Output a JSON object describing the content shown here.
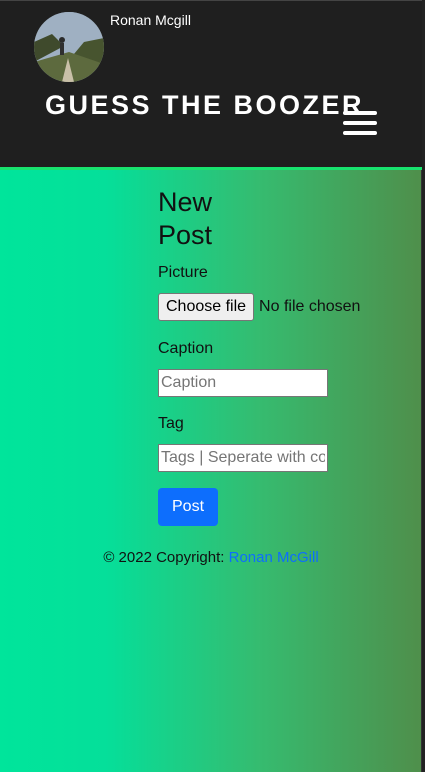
{
  "header": {
    "username": "Ronan Mcgill",
    "brand": "GUESS THE BOOZER",
    "menu_icon": "hamburger-menu-icon"
  },
  "form": {
    "title": "New Post",
    "picture_label": "Picture",
    "file_button": "Choose file",
    "file_status": "No file chosen",
    "caption_label": "Caption",
    "caption_placeholder": "Caption",
    "tag_label": "Tag",
    "tag_placeholder": "Tags | Seperate with commas",
    "submit_label": "Post"
  },
  "footer": {
    "copyright": "© 2022 Copyright: ",
    "author_link": "Ronan McGill"
  },
  "colors": {
    "navbar": "#1f1f1f",
    "accent_border": "#18e26e",
    "button_primary": "#0d6efd",
    "gradient_start": "#00e59b",
    "gradient_end": "#4f8f4b"
  }
}
